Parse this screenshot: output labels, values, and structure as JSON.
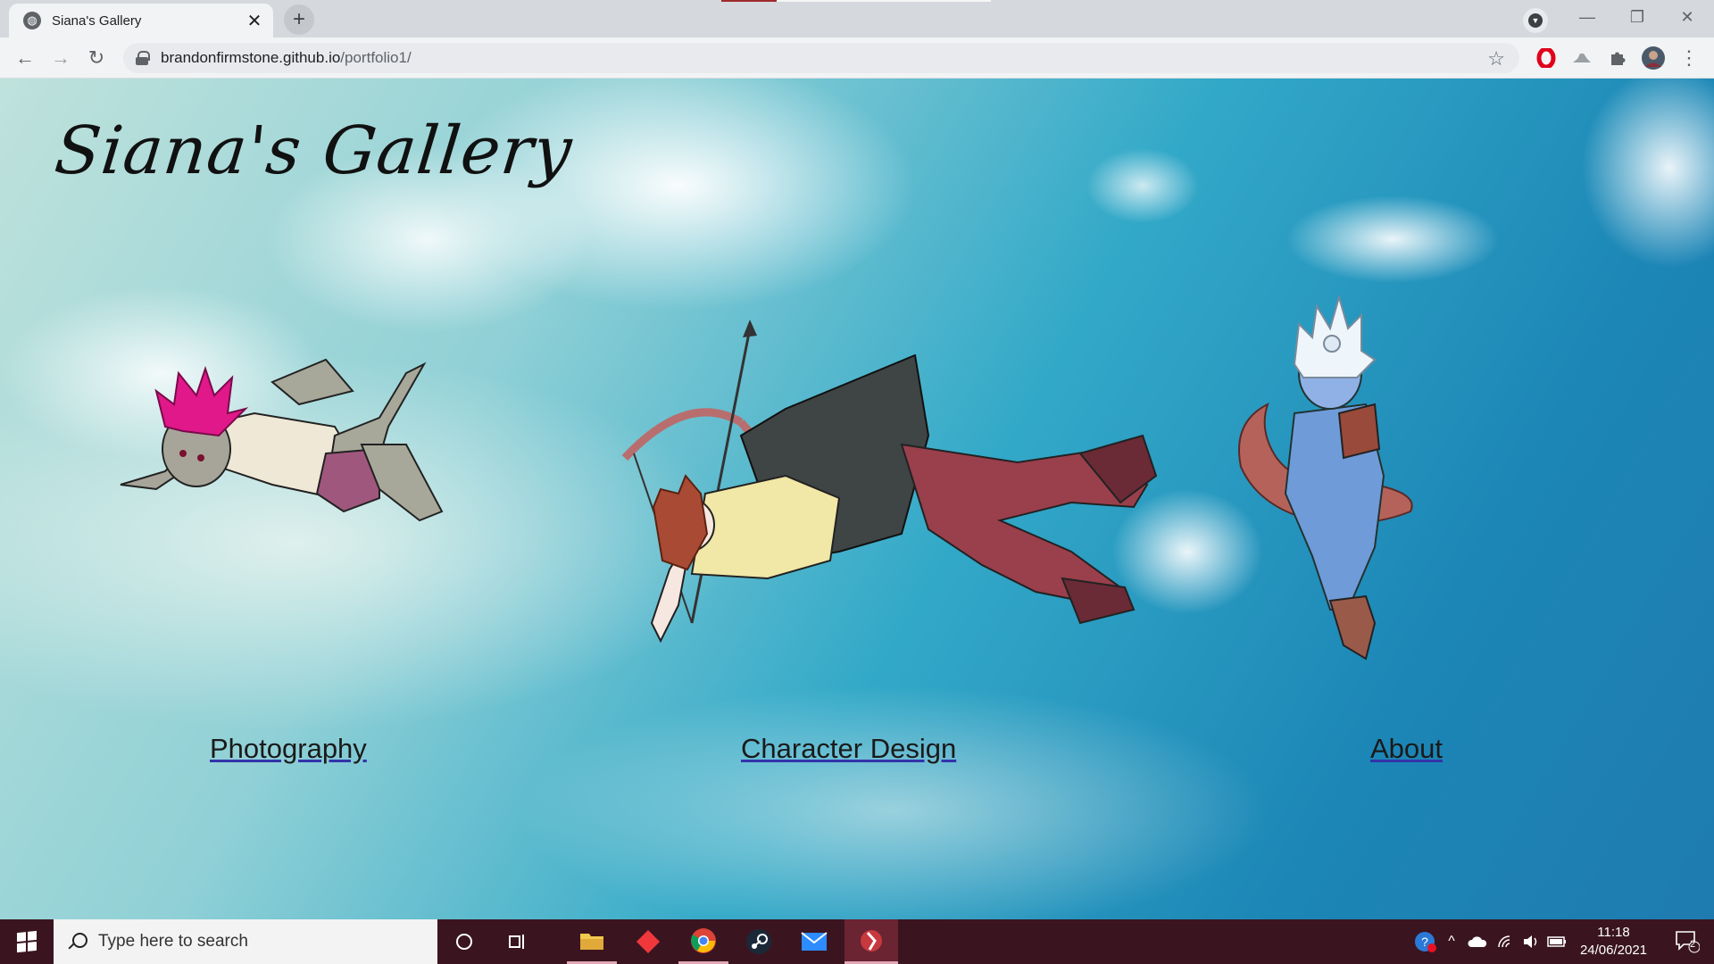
{
  "browser": {
    "tab_title": "Siana's Gallery",
    "tab_close": "✕",
    "new_tab": "+",
    "url_domain": "brandonfirmstone.github.io",
    "url_path": "/portfolio1/",
    "back": "←",
    "forward": "→",
    "reload": "↻",
    "star": "☆",
    "minimize": "—",
    "restore": "❐",
    "close": "✕",
    "more": "⋮"
  },
  "page": {
    "title": "Siana's Gallery",
    "nav": [
      {
        "label": "Photography"
      },
      {
        "label": "Character Design"
      },
      {
        "label": "About"
      }
    ]
  },
  "taskbar": {
    "search_placeholder": "Type here to search",
    "time": "11:18",
    "date": "24/06/2021",
    "notification_count": "2"
  },
  "colors": {
    "sky_accent": "#1c86b6",
    "taskbar": "#3a1520",
    "tab_active": "#f1f3f4"
  }
}
